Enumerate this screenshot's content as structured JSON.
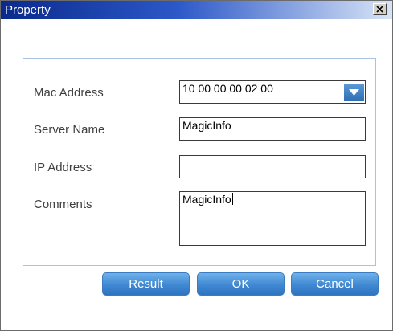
{
  "dialog": {
    "title": "Property"
  },
  "form": {
    "mac_address": {
      "label": "Mac Address",
      "value": "10 00 00 00 02 00"
    },
    "server_name": {
      "label": "Server Name",
      "value": "MagicInfo"
    },
    "ip_address": {
      "label": "IP Address",
      "value": ""
    },
    "comments": {
      "label": "Comments",
      "value": "MagicInfo"
    }
  },
  "buttons": {
    "result": "Result",
    "ok": "OK",
    "cancel": "Cancel"
  },
  "icons": {
    "close": "close-icon",
    "dropdown": "chevron-down-icon"
  },
  "colors": {
    "title_start": "#0a2a8c",
    "title_end": "#d8e4f6",
    "button": "#3f88d2",
    "group_border": "#a9c2e0"
  }
}
